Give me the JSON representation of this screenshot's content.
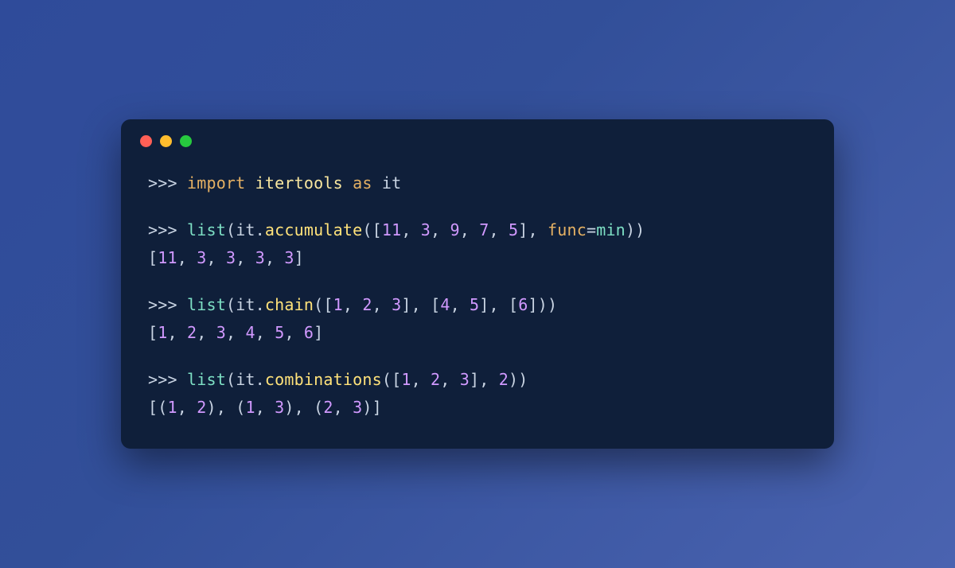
{
  "traffic_lights": [
    "red",
    "yellow",
    "green"
  ],
  "code": {
    "l1": {
      "prompt": ">>> ",
      "kw_import": "import",
      "sp1": " ",
      "module": "itertools",
      "sp2": " ",
      "kw_as": "as",
      "sp3": " ",
      "alias": "it"
    },
    "l2": {
      "prompt": ">>> ",
      "fn_list": "list",
      "open1": "(",
      "obj": "it",
      "dot": ".",
      "method": "accumulate",
      "open2": "([",
      "n1": "11",
      "c1": ", ",
      "n2": "3",
      "c2": ", ",
      "n3": "9",
      "c3": ", ",
      "n4": "7",
      "c4": ", ",
      "n5": "5",
      "close_args": "], ",
      "kw_func": "func",
      "eq": "=",
      "fn_min": "min",
      "close": "))"
    },
    "l2r": {
      "open": "[",
      "n1": "11",
      "c1": ", ",
      "n2": "3",
      "c2": ", ",
      "n3": "3",
      "c3": ", ",
      "n4": "3",
      "c4": ", ",
      "n5": "3",
      "close": "]"
    },
    "l3": {
      "prompt": ">>> ",
      "fn_list": "list",
      "open1": "(",
      "obj": "it",
      "dot": ".",
      "method": "chain",
      "open2": "([",
      "a1": "1",
      "ac1": ", ",
      "a2": "2",
      "ac2": ", ",
      "a3": "3",
      "mid1": "], [",
      "b1": "4",
      "bc1": ", ",
      "b2": "5",
      "mid2": "], [",
      "c1": "6",
      "close": "]))"
    },
    "l3r": {
      "open": "[",
      "n1": "1",
      "c1": ", ",
      "n2": "2",
      "c2": ", ",
      "n3": "3",
      "c3": ", ",
      "n4": "4",
      "c4": ", ",
      "n5": "5",
      "c5": ", ",
      "n6": "6",
      "close": "]"
    },
    "l4": {
      "prompt": ">>> ",
      "fn_list": "list",
      "open1": "(",
      "obj": "it",
      "dot": ".",
      "method": "combinations",
      "open2": "([",
      "a1": "1",
      "ac1": ", ",
      "a2": "2",
      "ac2": ", ",
      "a3": "3",
      "mid": "], ",
      "k": "2",
      "close": "))"
    },
    "l4r": {
      "open": "[(",
      "p1a": "1",
      "p1c": ", ",
      "p1b": "2",
      "sep1": "), (",
      "p2a": "1",
      "p2c": ", ",
      "p2b": "3",
      "sep2": "), (",
      "p3a": "2",
      "p3c": ", ",
      "p3b": "3",
      "close": ")]"
    }
  }
}
